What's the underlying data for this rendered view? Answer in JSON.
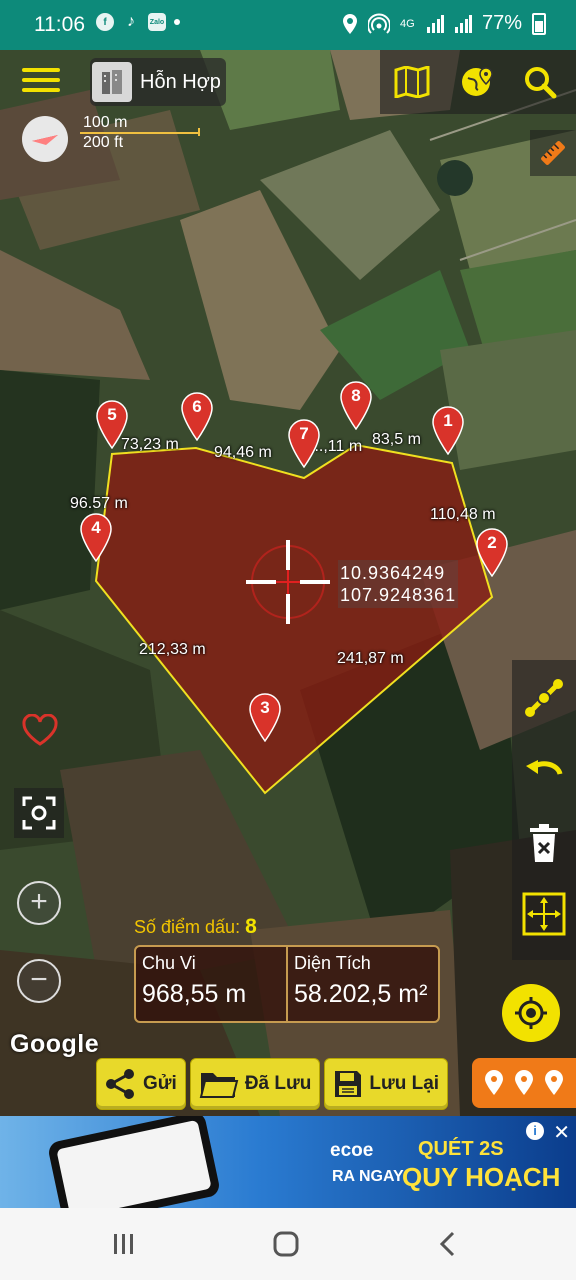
{
  "status_bar": {
    "time": "11:06",
    "app_icons": [
      "facebook-icon",
      "tiktok-icon",
      "zalo-icon"
    ],
    "zalo_label": "Zalo",
    "battery": "77%",
    "network": "4G"
  },
  "map_controls": {
    "map_type": "Hỗn Hợp",
    "scale_metric": "100 m",
    "scale_imperial": "200 ft"
  },
  "colors": {
    "accent_yellow": "#f2e200",
    "polygon_fill": "#8b1c12",
    "polygon_stroke": "#f0e020",
    "pin_red": "#d9332a",
    "status_bar": "#0d8a7a",
    "pins_button": "#f07a18"
  },
  "markers": [
    "1",
    "2",
    "3",
    "4",
    "5",
    "6",
    "7",
    "8"
  ],
  "distances": {
    "d12": "110,48 m",
    "d23": "241,87 m",
    "d34": "212,33 m",
    "d45": "96.57 m",
    "d56": "73,23 m",
    "d67": "94,46 m",
    "d78": "...,11 m",
    "d81": "83,5 m"
  },
  "center": {
    "lat": "10.9364249",
    "lng": "107.9248361"
  },
  "stats": {
    "points_label": "Số điểm dấu:",
    "points_value": "8",
    "perimeter_label": "Chu Vi",
    "perimeter_value": "968,55 m",
    "area_label": "Diện Tích",
    "area_value": "58.202,5  m²"
  },
  "google_logo": "Google",
  "actions": {
    "send": "Gửi",
    "saved": "Đã Lưu",
    "save": "Lưu Lại"
  },
  "ad": {
    "brand": "ecoe",
    "line1": "QUÉT 2S",
    "line2a": "RA NGAY",
    "line2b": "QUY HOẠCH"
  }
}
